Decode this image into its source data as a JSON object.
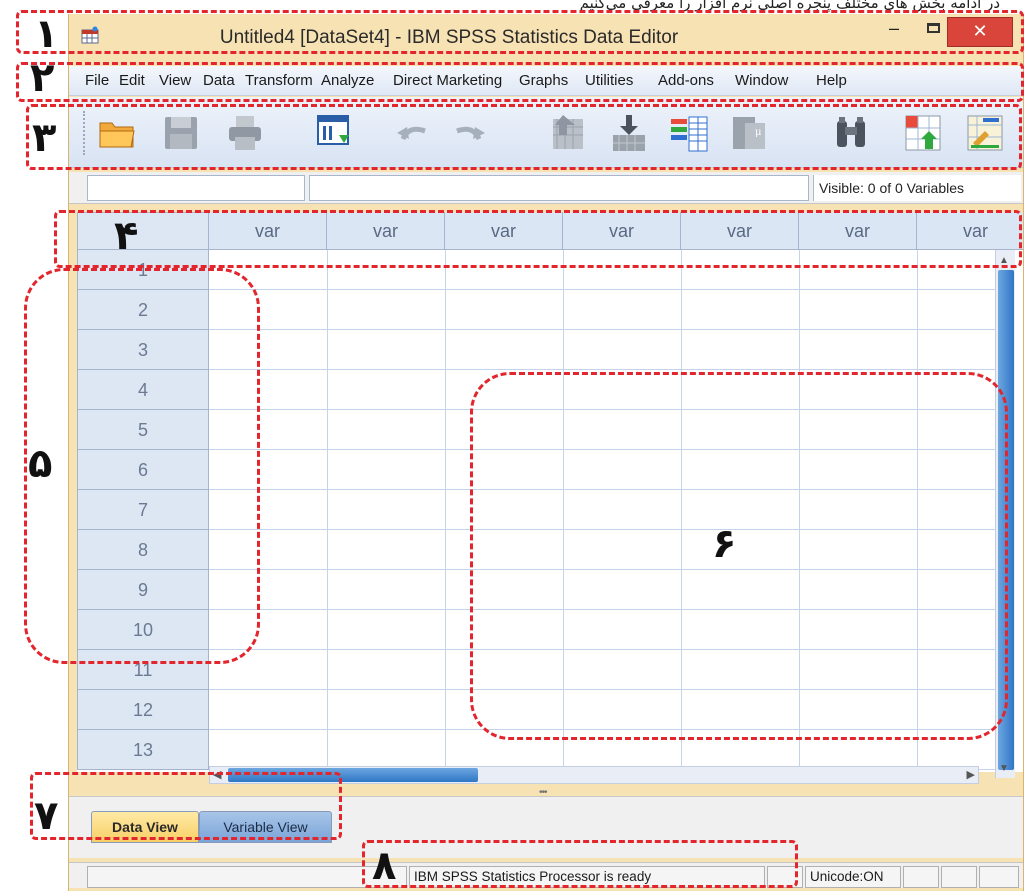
{
  "caption": "در ادامه بخش های مختلف پنجره اصلی نرم افزار را معرفی می‌کنیم",
  "window": {
    "title": "Untitled4 [DataSet4] - IBM SPSS Statistics Data Editor",
    "minimize_glyph": "–",
    "close_glyph": "✕"
  },
  "menu": [
    "File",
    "Edit",
    "View",
    "Data",
    "Transform",
    "Analyze",
    "Direct Marketing",
    "Graphs",
    "Utilities",
    "Add-ons",
    "Window",
    "Help"
  ],
  "toolbar": {
    "buttons": [
      "open-data-icon",
      "save-icon",
      "print-icon",
      "recall-dialog-icon",
      "undo-icon",
      "redo-icon",
      "goto-case-icon",
      "goto-variable-icon",
      "variables-icon",
      "run-descriptives-icon",
      "find-icon",
      "insert-cases-icon",
      "insert-variable-icon"
    ]
  },
  "infobar": {
    "visible_text": "Visible: 0 of 0 Variables"
  },
  "grid": {
    "column_header": "var",
    "column_count": 7,
    "rows": [
      "1",
      "2",
      "3",
      "4",
      "5",
      "6",
      "7",
      "8",
      "9",
      "10",
      "11",
      "12",
      "13"
    ]
  },
  "tabs": {
    "data_view": "Data View",
    "variable_view": "Variable View"
  },
  "status": {
    "processor": "IBM SPSS Statistics Processor is ready",
    "unicode": "Unicode:ON"
  },
  "annotations": [
    "۱",
    "۲",
    "۳",
    "۴",
    "۵",
    "۶",
    "۷",
    "۸"
  ],
  "colors": {
    "annotation": "#e3262d",
    "title_bar": "#f7e2b3",
    "close_button": "#d9443b",
    "active_tab": "#f7cf66",
    "inactive_tab": "#7aa4d8"
  }
}
